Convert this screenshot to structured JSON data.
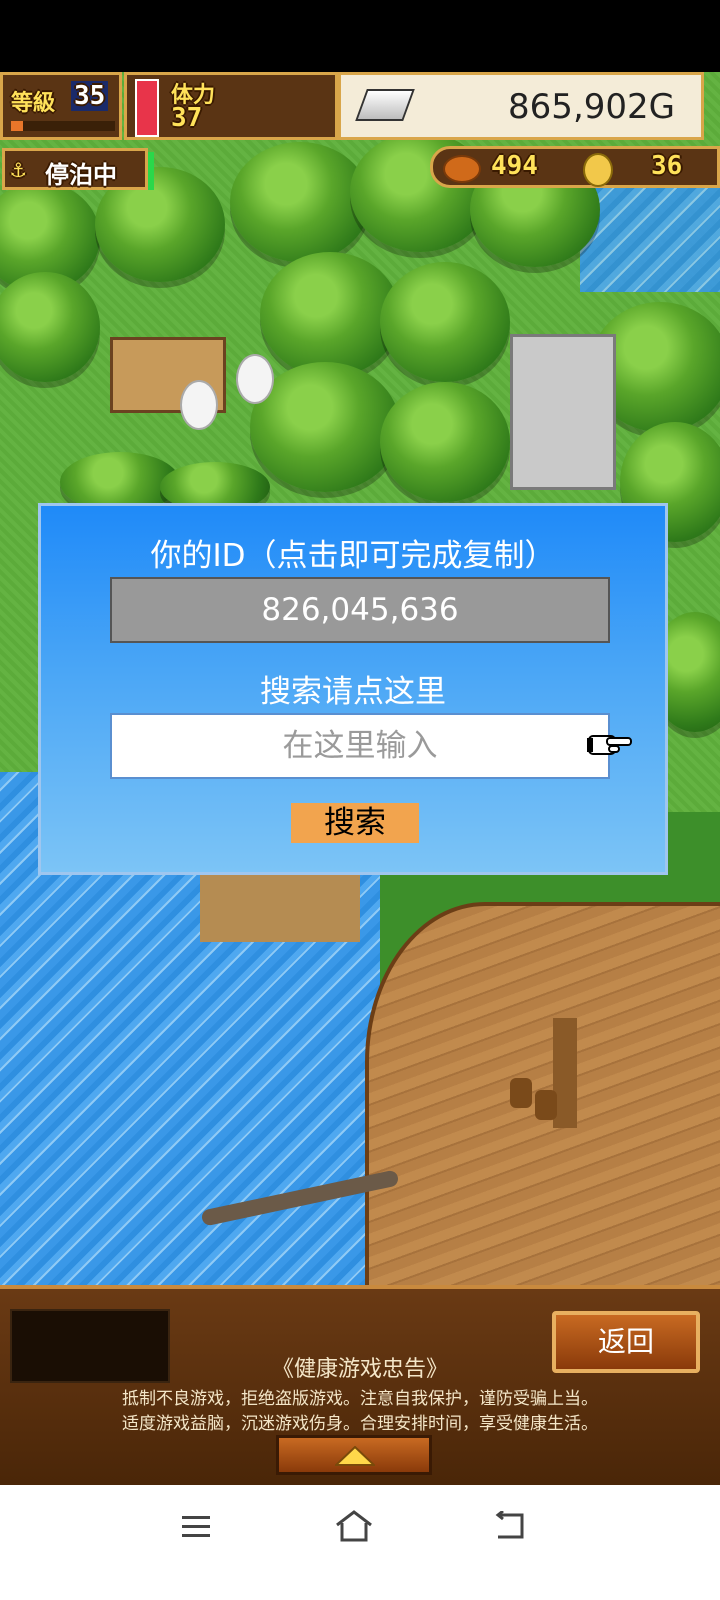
{
  "hud": {
    "level_label": "等級",
    "level_value": "35",
    "stamina_label": "体力",
    "stamina_value": "37",
    "money": "865,902G",
    "status": "停泊中",
    "food_count": "494",
    "medal_count": "36"
  },
  "dialog": {
    "id_title": "你的ID（点击即可完成复制）",
    "id_value": "826,045,636",
    "search_title": "搜索请点这里",
    "search_placeholder": "在这里输入",
    "search_button": "搜索"
  },
  "bottom": {
    "back_button": "返回",
    "notice_title": "《健康游戏忠告》",
    "notice_line1": "抵制不良游戏，拒绝盗版游戏。注意自我保护，谨防受骗上当。",
    "notice_line2": "适度游戏益脑，沉迷游戏伤身。合理安排时间，享受健康生活。"
  },
  "navbar": {
    "icons": [
      "menu-icon",
      "home-icon",
      "back-icon"
    ]
  },
  "colors": {
    "dialog_blue": "#1f8af8",
    "search_button": "#f2a44e",
    "hud_brown": "#5a3414",
    "hud_gold": "#ffe25a"
  }
}
